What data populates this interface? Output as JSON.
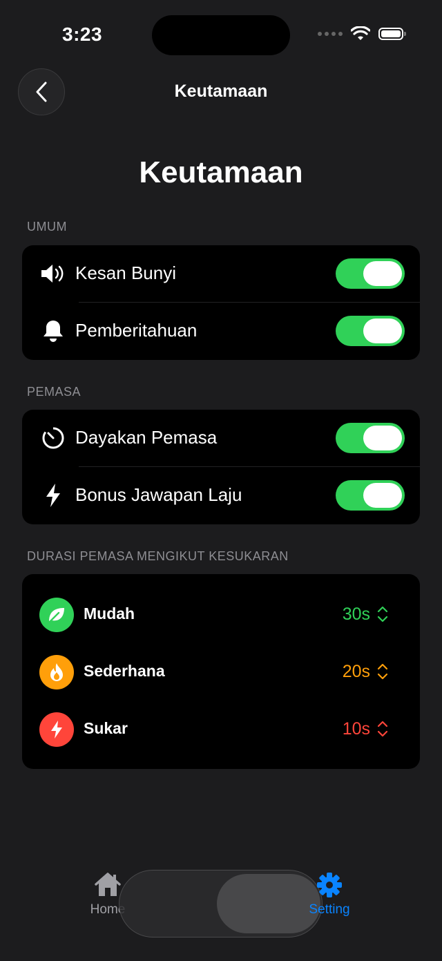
{
  "status": {
    "time": "3:23"
  },
  "nav": {
    "title": "Keutamaan"
  },
  "page": {
    "title": "Keutamaan"
  },
  "sections": {
    "general": {
      "header": "UMUM",
      "items": [
        {
          "label": "Kesan Bunyi",
          "icon": "speaker-icon",
          "on": true
        },
        {
          "label": "Pemberitahuan",
          "icon": "bell-icon",
          "on": true
        }
      ]
    },
    "timer": {
      "header": "PEMASA",
      "items": [
        {
          "label": "Dayakan Pemasa",
          "icon": "timer-icon",
          "on": true
        },
        {
          "label": "Bonus Jawapan Laju",
          "icon": "bolt-icon",
          "on": true
        }
      ]
    },
    "difficulty": {
      "header": "DURASI PEMASA MENGIKUT KESUKARAN",
      "items": [
        {
          "label": "Mudah",
          "value": "30s",
          "color": "#30d158",
          "icon": "leaf-icon"
        },
        {
          "label": "Sederhana",
          "value": "20s",
          "color": "#ff9f0a",
          "icon": "flame-icon"
        },
        {
          "label": "Sukar",
          "value": "10s",
          "color": "#ff453a",
          "icon": "bolt-icon"
        }
      ]
    }
  },
  "tabs": [
    {
      "label": "Home",
      "icon": "house-icon"
    },
    {
      "label": "Setting",
      "icon": "gear-icon",
      "active": true
    }
  ],
  "colors": {
    "accent": "#0a84ff",
    "toggle_on": "#30d158"
  }
}
